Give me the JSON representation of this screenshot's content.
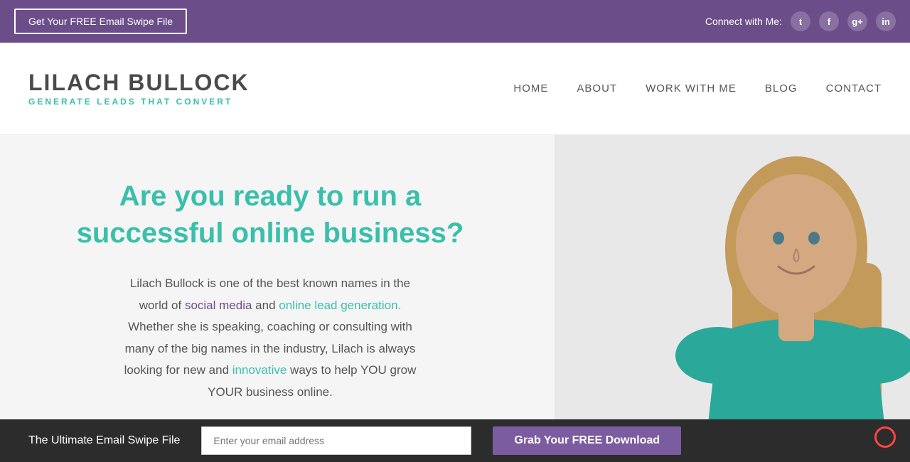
{
  "topbar": {
    "email_swipe_label": "Get Your FREE Email Swipe File",
    "connect_label": "Connect with Me:",
    "social": [
      {
        "name": "twitter",
        "icon": "𝕏",
        "symbol": "t"
      },
      {
        "name": "facebook",
        "icon": "f",
        "symbol": "f"
      },
      {
        "name": "googleplus",
        "icon": "g+",
        "symbol": "g+"
      },
      {
        "name": "extra",
        "icon": "in",
        "symbol": "in"
      }
    ]
  },
  "header": {
    "logo_name": "LILACH BULLOCK",
    "logo_tagline_start": "GENERATE LEADS THAT ",
    "logo_tagline_highlight": "CONVERT",
    "nav": [
      {
        "label": "HOME",
        "id": "home"
      },
      {
        "label": "ABOUT",
        "id": "about"
      },
      {
        "label": "WORK WITH ME",
        "id": "work-with-me"
      },
      {
        "label": "BLOG",
        "id": "blog"
      },
      {
        "label": "CONTACT",
        "id": "contact"
      }
    ]
  },
  "hero": {
    "heading": "Are you ready to run a successful online business?",
    "body_line1": "Lilach Bullock is one of the best known names in the",
    "body_line2": "world of",
    "body_highlight1": "social media",
    "body_line3": "and",
    "body_highlight2": "online lead generation.",
    "body_line4": "Whether she is speaking, coaching or consulting with",
    "body_line5": "many of the big names in the industry, Lilach is always",
    "body_line6": "looking for new and",
    "body_highlight3": "innovative",
    "body_line7": "ways to help YOU grow",
    "body_line8": "YOUR business online."
  },
  "bottombar": {
    "label": "The Ultimate Email Swipe File",
    "input_placeholder": "Enter your email address",
    "button_label": "Grab Your FREE Download"
  }
}
